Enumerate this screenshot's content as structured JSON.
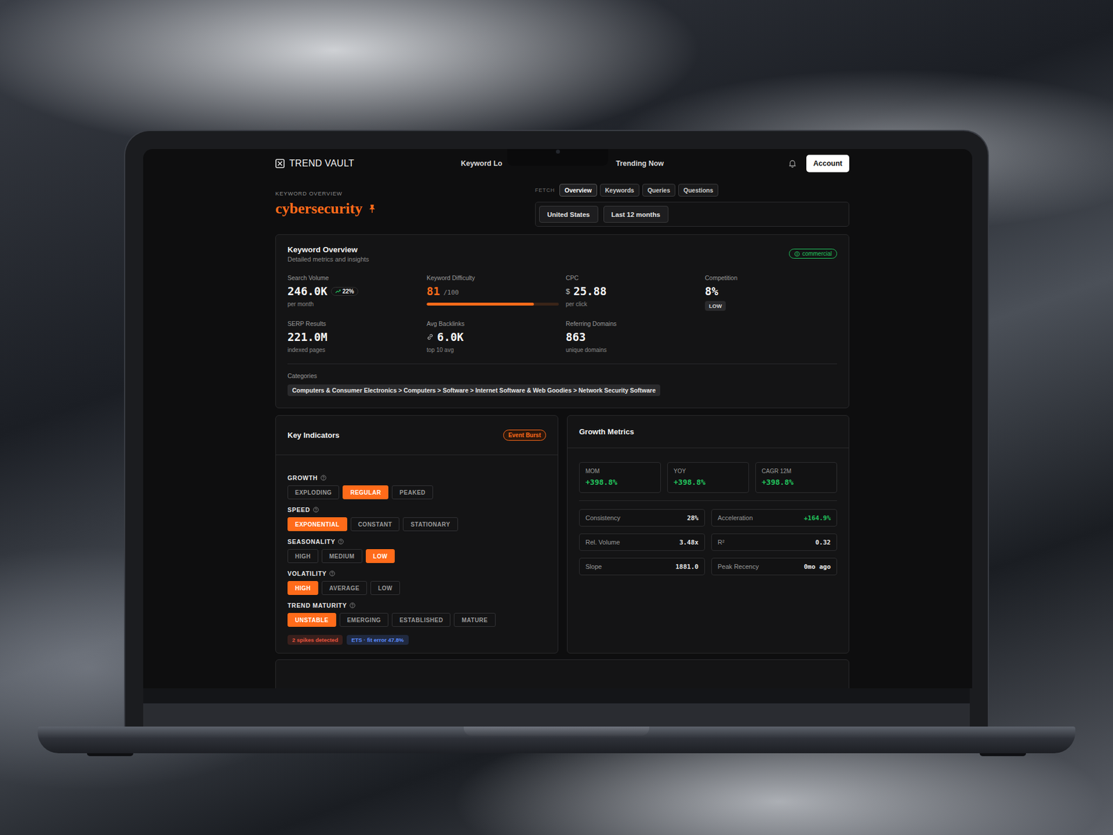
{
  "app": {
    "logo": "TREND VAULT",
    "nav": [
      {
        "label": "Keyword Lo"
      },
      {
        "label": "Trending Now"
      }
    ],
    "account": "Account"
  },
  "header": {
    "eyebrow": "KEYWORD OVERVIEW",
    "keyword": "cybersecurity",
    "pinned": true,
    "fetch_label": "FETCH",
    "fetch_tabs": [
      {
        "label": "Overview",
        "selected": true
      },
      {
        "label": "Keywords",
        "selected": false
      },
      {
        "label": "Queries",
        "selected": false
      },
      {
        "label": "Questions",
        "selected": false
      }
    ],
    "filters": [
      "United States",
      "Last 12 months"
    ]
  },
  "overview": {
    "title": "Keyword Overview",
    "subtitle": "Detailed metrics and insights",
    "intent": "commercial",
    "search_volume": {
      "label": "Search Volume",
      "value": "246.0K",
      "trend": "22%",
      "sub": "per month"
    },
    "difficulty": {
      "label": "Keyword Difficulty",
      "value": "81",
      "max": "/100",
      "level": 0.81
    },
    "cpc": {
      "label": "CPC",
      "currency": "$",
      "value": "25.88",
      "sub": "per click"
    },
    "competition": {
      "label": "Competition",
      "value": "8%",
      "tag": "LOW"
    },
    "secondary": [
      {
        "label": "SERP Results",
        "value": "221.0M",
        "sub": "indexed pages",
        "kind": "plain"
      },
      {
        "label": "Avg Backlinks",
        "value": "6.0K",
        "sub": "top 10 avg",
        "kind": "link"
      },
      {
        "label": "Referring Domains",
        "value": "863",
        "sub": "unique domains",
        "kind": "plain"
      }
    ],
    "categories_label": "Categories",
    "categories": "Computers & Consumer Electronics > Computers > Software > Internet Software & Web Goodies > Network Security Software"
  },
  "indicators": {
    "title": "Key Indicators",
    "badge": "Event Burst",
    "groups": [
      {
        "label": "GROWTH",
        "options": [
          {
            "label": "EXPLODING",
            "selected": false
          },
          {
            "label": "REGULAR",
            "selected": true
          },
          {
            "label": "PEAKED",
            "selected": false
          }
        ]
      },
      {
        "label": "SPEED",
        "options": [
          {
            "label": "EXPONENTIAL",
            "selected": true
          },
          {
            "label": "CONSTANT",
            "selected": false
          },
          {
            "label": "STATIONARY",
            "selected": false
          }
        ]
      },
      {
        "label": "SEASONALITY",
        "options": [
          {
            "label": "HIGH",
            "selected": false
          },
          {
            "label": "MEDIUM",
            "selected": false
          },
          {
            "label": "LOW",
            "selected": true
          }
        ]
      },
      {
        "label": "VOLATILITY",
        "options": [
          {
            "label": "HIGH",
            "selected": true
          },
          {
            "label": "AVERAGE",
            "selected": false
          },
          {
            "label": "LOW",
            "selected": false
          }
        ]
      },
      {
        "label": "TREND MATURITY",
        "options": [
          {
            "label": "UNSTABLE",
            "selected": true
          },
          {
            "label": "EMERGING",
            "selected": false
          },
          {
            "label": "ESTABLISHED",
            "selected": false
          },
          {
            "label": "MATURE",
            "selected": false
          }
        ]
      }
    ],
    "tags": [
      {
        "label": "2 spikes detected",
        "color": "#e5533d"
      },
      {
        "label": "ETS · fit error 47.8%",
        "color": "#5b8cff"
      }
    ]
  },
  "growth": {
    "title": "Growth Metrics",
    "periods": [
      {
        "label": "MOM",
        "value": "+398.8%"
      },
      {
        "label": "YOY",
        "value": "+398.8%"
      },
      {
        "label": "CAGR 12M",
        "value": "+398.8%"
      }
    ],
    "stats": [
      {
        "label": "Consistency",
        "value": "28%",
        "positive": false
      },
      {
        "label": "Acceleration",
        "value": "+164.9%",
        "positive": true
      },
      {
        "label": "Rel. Volume",
        "value": "3.48x",
        "positive": false
      },
      {
        "label": "R²",
        "value": "0.32",
        "positive": false
      },
      {
        "label": "Slope",
        "value": "1881.0",
        "positive": false
      },
      {
        "label": "Peak Recency",
        "value": "0mo ago",
        "positive": false
      }
    ]
  }
}
